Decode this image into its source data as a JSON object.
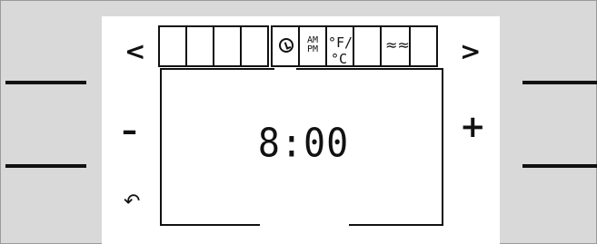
{
  "controls": {
    "prev": "<",
    "next": ">",
    "minus": "–",
    "plus": "+",
    "back": "↶"
  },
  "tabs": [
    {
      "id": "t1",
      "label": "",
      "icon": null
    },
    {
      "id": "t2",
      "label": "",
      "icon": null
    },
    {
      "id": "t3",
      "label": "",
      "icon": null
    },
    {
      "id": "t4",
      "label": "",
      "icon": null
    },
    {
      "id": "clock",
      "label": "",
      "icon": "clock-icon"
    },
    {
      "id": "ampm",
      "label": "AM\nPM",
      "icon": "am-pm-icon"
    },
    {
      "id": "temp",
      "label": "°F/°C",
      "icon": "temperature-unit-icon"
    },
    {
      "id": "t8",
      "label": "",
      "icon": null
    },
    {
      "id": "waves",
      "label": "≈≈",
      "icon": "waves-icon"
    },
    {
      "id": "t10",
      "label": "",
      "icon": null
    }
  ],
  "display": {
    "time": "8:00"
  }
}
